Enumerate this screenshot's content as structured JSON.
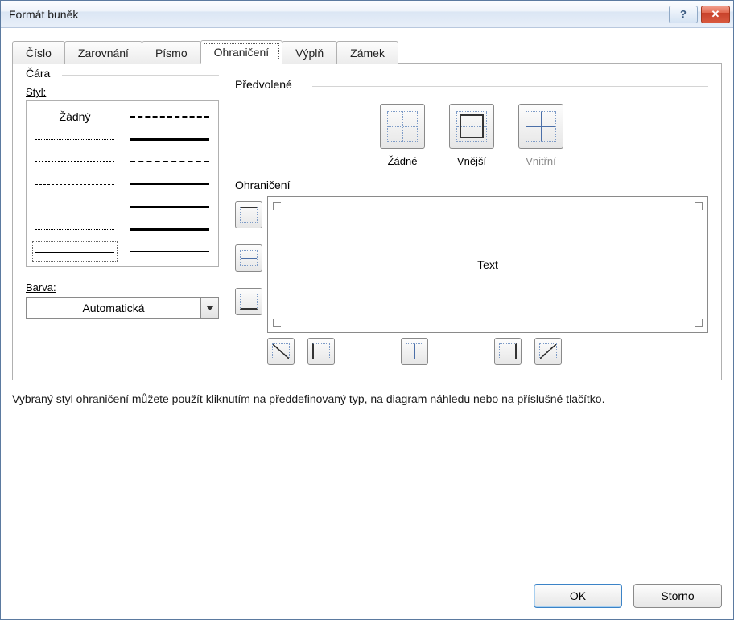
{
  "window": {
    "title": "Formát buněk"
  },
  "tabs": {
    "number": {
      "label": "Číslo"
    },
    "align": {
      "label": "Zarovnání"
    },
    "font": {
      "label": "Písmo"
    },
    "border": {
      "label": "Ohraničení"
    },
    "fill": {
      "label": "Výplň"
    },
    "protect": {
      "label": "Zámek"
    },
    "selected": "border"
  },
  "line": {
    "group_label": "Čára",
    "style_label": "Styl:",
    "none_label": "Žádný",
    "color_label": "Barva:",
    "color_value": "Automatická"
  },
  "presets": {
    "group_label": "Předvolené",
    "none": {
      "label": "Žádné"
    },
    "outer": {
      "label": "Vnější"
    },
    "inner": {
      "label": "Vnitřní",
      "enabled": false
    }
  },
  "border": {
    "group_label": "Ohraničení",
    "preview_text": "Text"
  },
  "hint": "Vybraný styl ohraničení můžete použít kliknutím na předdefinovaný typ, na diagram náhledu nebo na příslušné tlačítko.",
  "buttons": {
    "ok": "OK",
    "cancel": "Storno"
  }
}
